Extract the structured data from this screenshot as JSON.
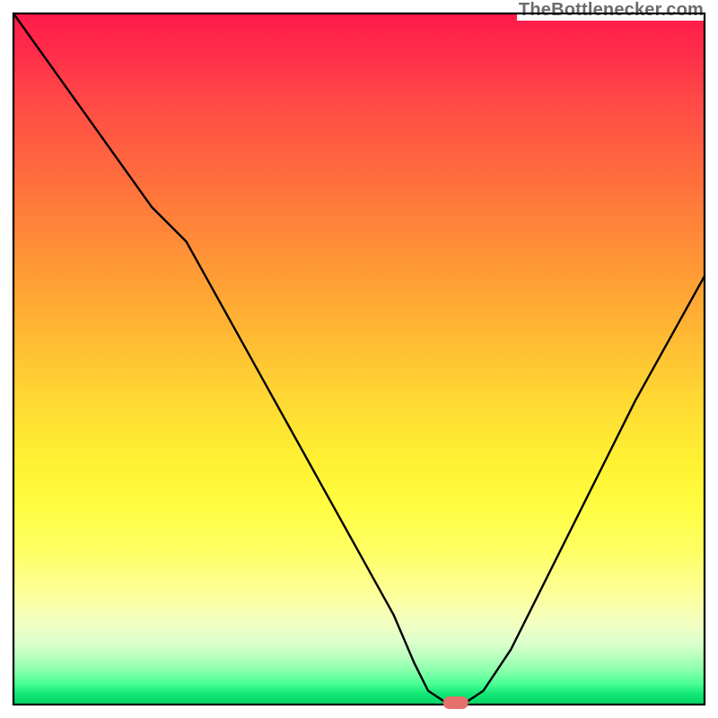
{
  "attribution": "TheBottlenecker.com",
  "chart_data": {
    "type": "line",
    "title": "",
    "xlabel": "",
    "ylabel": "",
    "xlim": [
      0,
      100
    ],
    "ylim": [
      0,
      100
    ],
    "notes": "V-shaped bottleneck curve over a red-to-green heat gradient. Axes are unlabeled; numeric values estimated from pixel positions as percentages of the plot area (0 = left/bottom, 100 = right/top). Lower y means less bottleneck (green). The small salmon pill marks the optimal point at the curve's minimum.",
    "series": [
      {
        "name": "bottleneck-curve",
        "x": [
          0,
          5,
          10,
          15,
          20,
          25,
          30,
          35,
          40,
          45,
          50,
          55,
          58,
          60,
          63,
          65,
          68,
          72,
          76,
          80,
          85,
          90,
          95,
          100
        ],
        "y": [
          100,
          93,
          86,
          79,
          72,
          67,
          58,
          49,
          40,
          31,
          22,
          13,
          6,
          2,
          0,
          0,
          2,
          8,
          16,
          24,
          34,
          44,
          53,
          62
        ]
      }
    ],
    "optimal_point": {
      "x": 64,
      "y": 0
    },
    "gradient_legend": {
      "top_color": "#ff1a4a",
      "mid_color": "#ffd233",
      "bottom_color": "#00d466",
      "meaning_top": "high bottleneck",
      "meaning_bottom": "no bottleneck"
    }
  }
}
